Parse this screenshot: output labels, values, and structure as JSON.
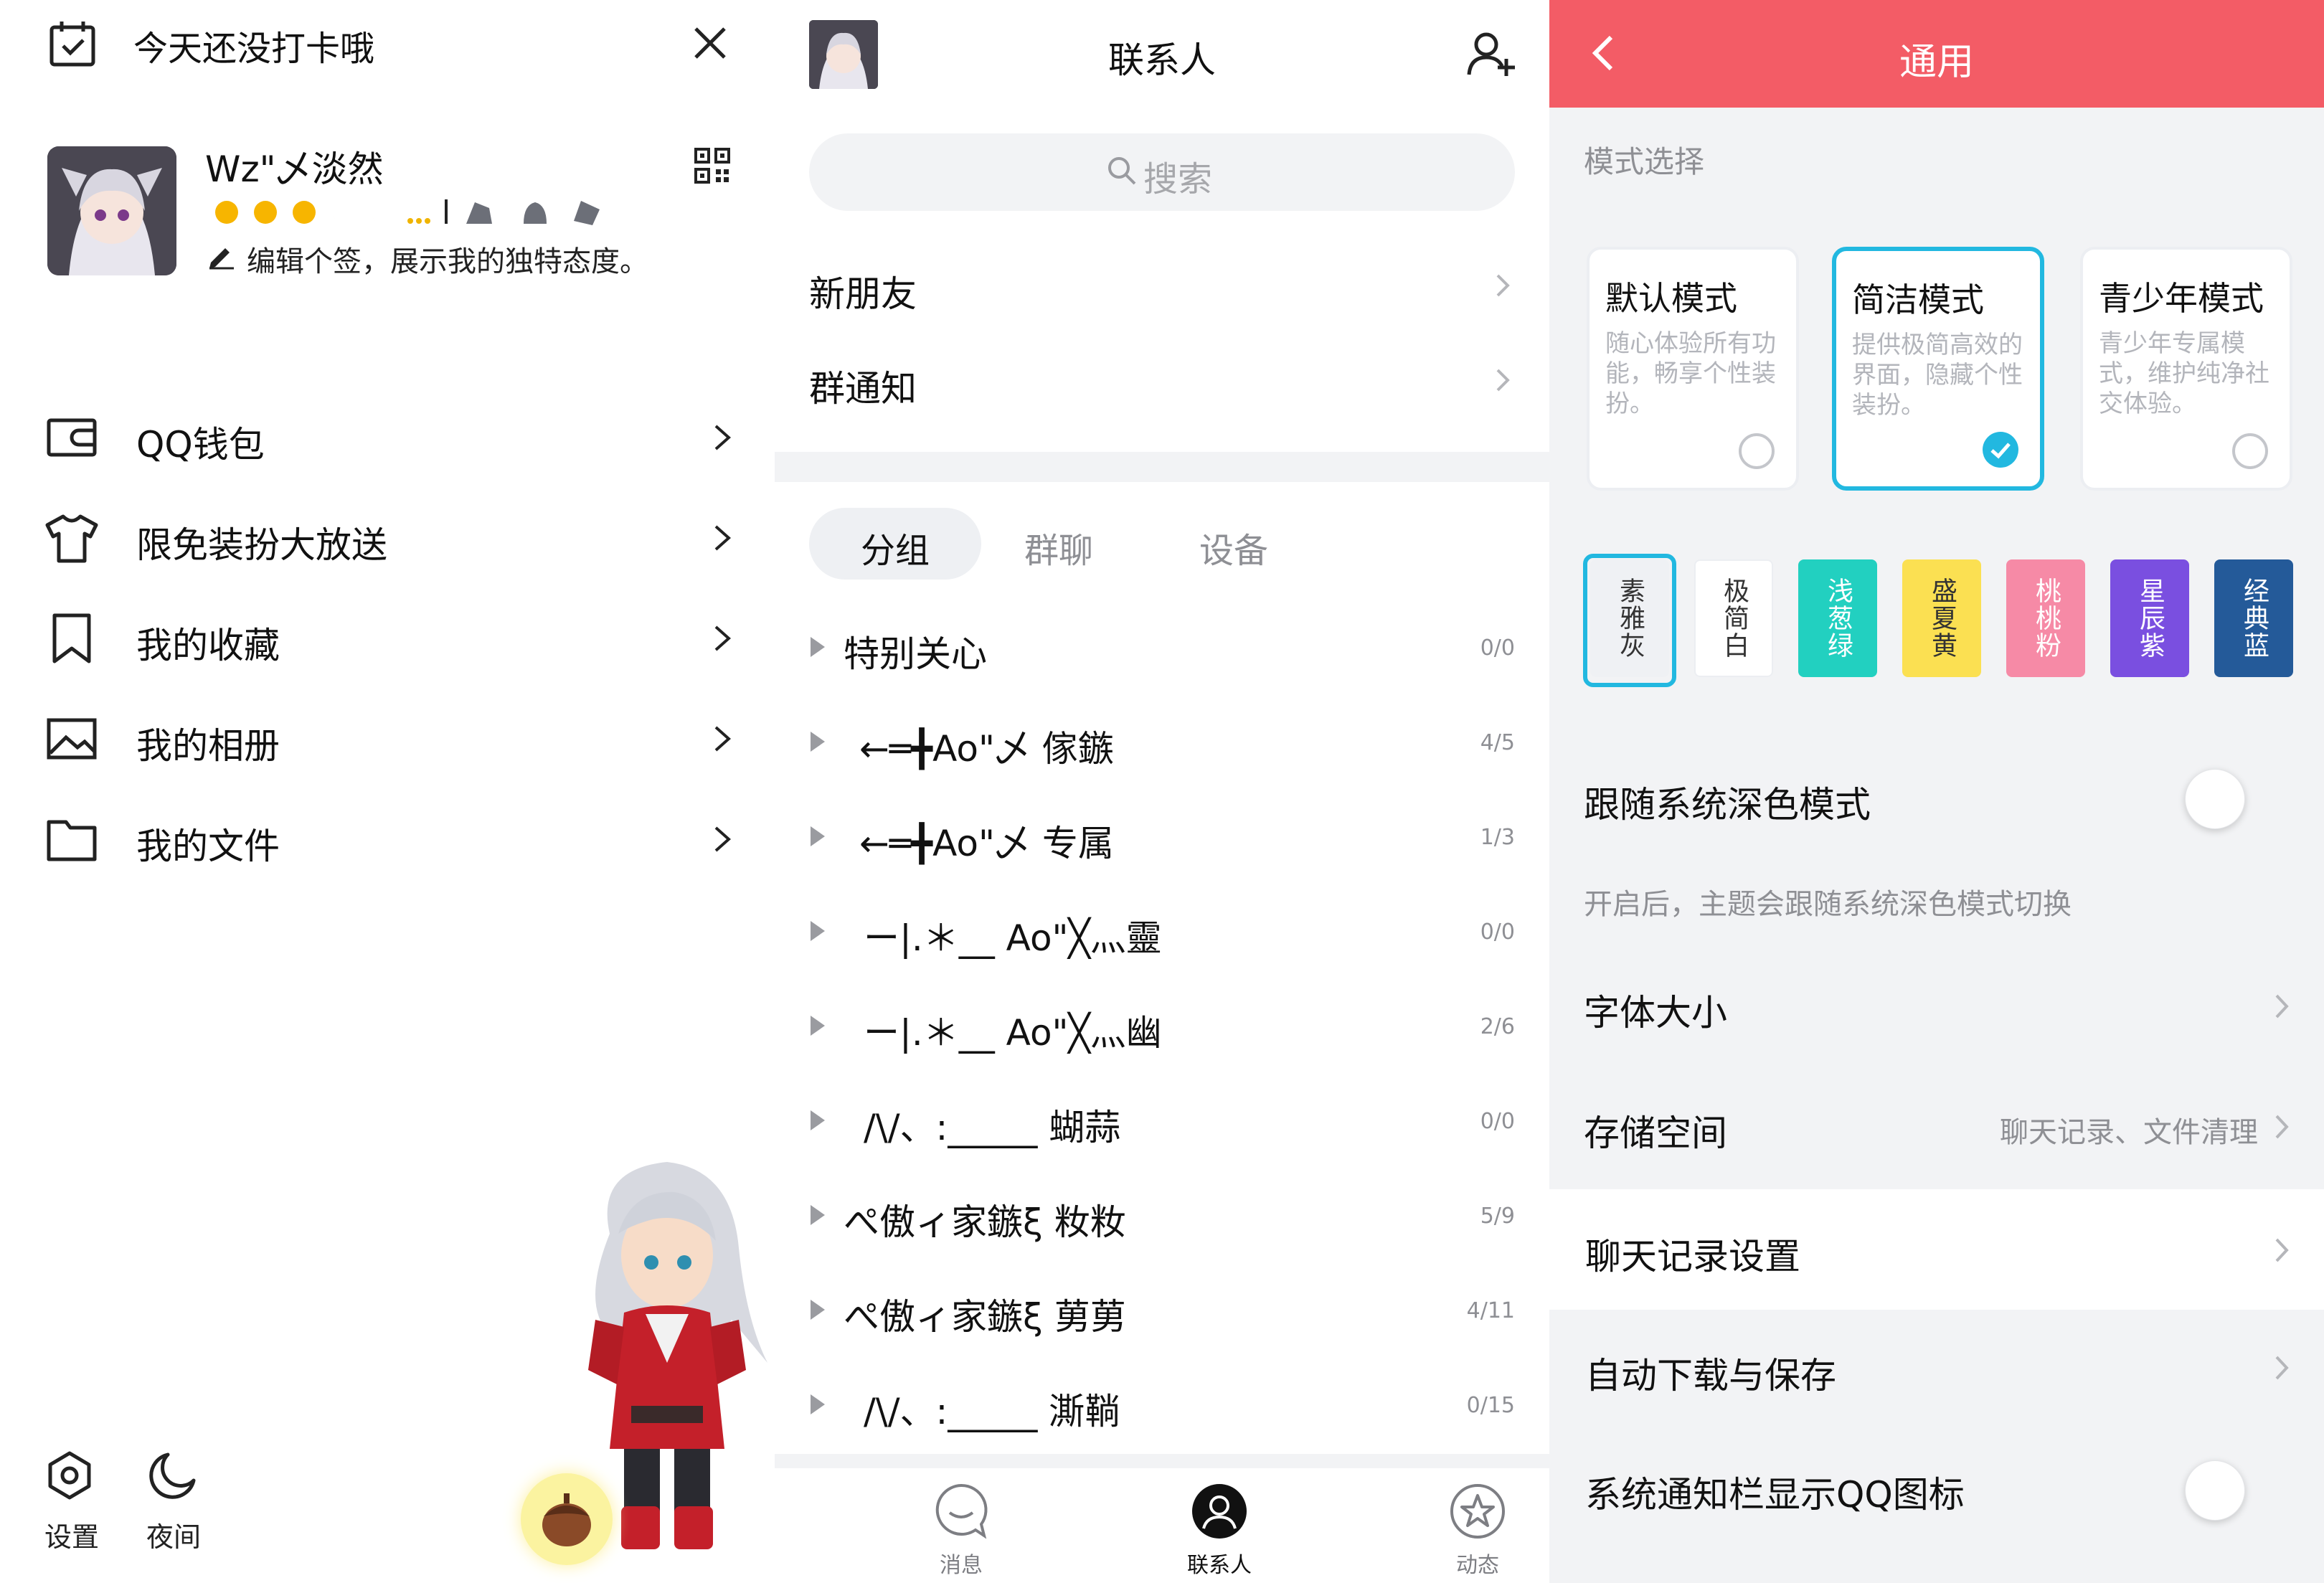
{
  "drawer": {
    "checkin_text": "今天还没打卡哦",
    "username": "Wz\"乄淡然",
    "signature": "编辑个签，展示我的独特态度。",
    "menu": [
      {
        "label": "QQ钱包",
        "icon": "wallet-icon"
      },
      {
        "label": "限免装扮大放送",
        "icon": "shirt-icon"
      },
      {
        "label": "我的收藏",
        "icon": "bookmark-icon"
      },
      {
        "label": "我的相册",
        "icon": "photo-icon"
      },
      {
        "label": "我的文件",
        "icon": "folder-icon"
      }
    ],
    "bottom": {
      "settings": "设置",
      "night": "夜间"
    }
  },
  "contacts": {
    "title": "联系人",
    "search_placeholder": "搜索",
    "new_friends": "新朋友",
    "group_notice": "群通知",
    "tabs": [
      "分组",
      "群聊",
      "设备"
    ],
    "groups": [
      {
        "name": "特别关心",
        "count": "0/0"
      },
      {
        "name": "←═╋Ao\"乄 傢鏃",
        "count": "4/5"
      },
      {
        "name": "←═╋Ao\"乄 专属",
        "count": "1/3"
      },
      {
        "name": "ー|.＊__ Ao\"╳灬靈",
        "count": "0/0"
      },
      {
        "name": "ー|.＊__ Ao\"╳灬幽",
        "count": "2/6"
      },
      {
        "name": "/\\/、:_____ 蝴蒜",
        "count": "0/0"
      },
      {
        "name": "ぺ傲ィ家鏃ξ 籹籹",
        "count": "5/9"
      },
      {
        "name": "ぺ傲ィ家鏃ξ 莮莮",
        "count": "4/11"
      },
      {
        "name": "/\\/、:_____ 澌鞝",
        "count": "0/15"
      }
    ],
    "nav": [
      {
        "label": "消息",
        "icon": "message-icon"
      },
      {
        "label": "联系人",
        "icon": "contacts-icon"
      },
      {
        "label": "动态",
        "icon": "star-icon"
      }
    ]
  },
  "settings": {
    "title": "通用",
    "mode_section": "模式选择",
    "modes": [
      {
        "title": "默认模式",
        "desc": "随心体验所有功能，畅享个性装扮。",
        "selected": false
      },
      {
        "title": "简洁模式",
        "desc": "提供极简高效的界面，隐藏个性装扮。",
        "selected": true
      },
      {
        "title": "青少年模式",
        "desc": "青少年专属模式，维护纯净社交体验。",
        "selected": false
      }
    ],
    "themes": [
      {
        "label": "素雅灰",
        "bg": "#eff1f4",
        "fg": "#333333",
        "selected": true
      },
      {
        "label": "极简白",
        "bg": "#ffffff",
        "fg": "#333333",
        "selected": false
      },
      {
        "label": "浅葱绿",
        "bg": "#22d0c0",
        "fg": "#ffffff",
        "selected": false
      },
      {
        "label": "盛夏黄",
        "bg": "#fbe052",
        "fg": "#333333",
        "selected": false
      },
      {
        "label": "桃桃粉",
        "bg": "#f68aa6",
        "fg": "#ffffff",
        "selected": false
      },
      {
        "label": "星辰紫",
        "bg": "#7a4fe0",
        "fg": "#ffffff",
        "selected": false
      },
      {
        "label": "经典蓝",
        "bg": "#245a99",
        "fg": "#ffffff",
        "selected": false
      }
    ],
    "dark_follow": "跟随系统深色模式",
    "dark_note": "开启后，主题会跟随系统深色模式切换",
    "font_size": "字体大小",
    "storage": "存储空间",
    "storage_hint": "聊天记录、文件清理",
    "chat_record": "聊天记录设置",
    "auto_download": "自动下载与保存",
    "notify_icon": "系统通知栏显示QQ图标",
    "header_color": "#f35c66",
    "accent": "#22b8e0"
  }
}
